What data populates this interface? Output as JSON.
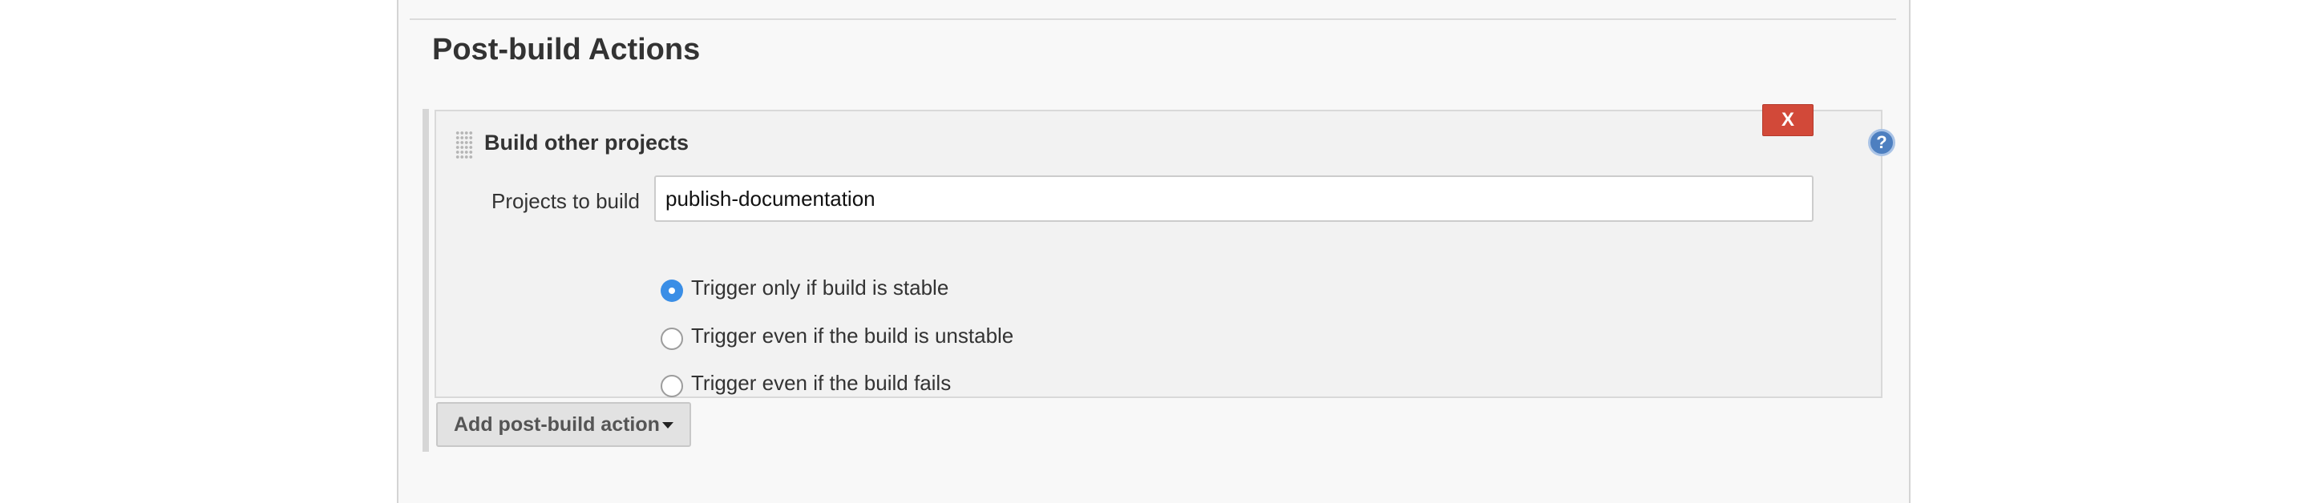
{
  "section": {
    "title": "Post-build Actions"
  },
  "action": {
    "title": "Build other projects",
    "delete_label": "X",
    "help_label": "?",
    "projects_label": "Projects to build",
    "projects_value": "publish-documentation",
    "trigger_options": [
      {
        "label": "Trigger only if build is stable",
        "selected": true
      },
      {
        "label": "Trigger even if the build is unstable",
        "selected": false
      },
      {
        "label": "Trigger even if the build fails",
        "selected": false
      }
    ]
  },
  "add_action": {
    "label": "Add post-build action",
    "icon": "caret-down-icon"
  },
  "colors": {
    "delete_button": "#d24939",
    "radio_selected": "#3a8ee6",
    "help_icon": "#4d7fc0"
  }
}
